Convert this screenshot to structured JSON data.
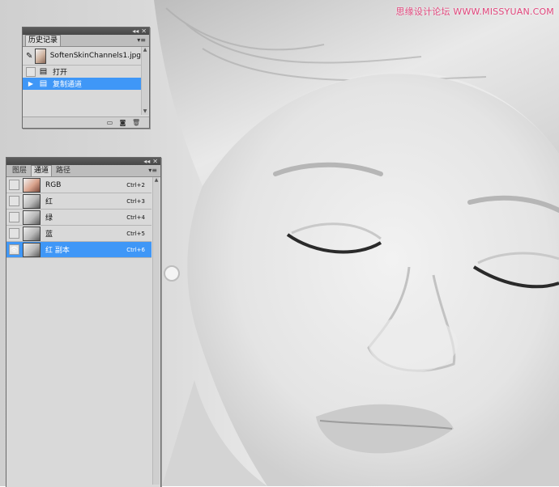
{
  "watermark": "思缘设计论坛 WWW.MISSYUAN.COM",
  "history_panel": {
    "tab": "历史记录",
    "snapshot": "SoftenSkinChannels1.jpg",
    "states": [
      {
        "label": "打开",
        "selected": false,
        "icon": "document-open-icon"
      },
      {
        "label": "复制通道",
        "selected": true,
        "icon": "duplicate-channel-icon"
      }
    ]
  },
  "channels_panel": {
    "tabs": [
      "图层",
      "通道",
      "路径"
    ],
    "active_tab": "通道",
    "channels": [
      {
        "name": "RGB",
        "shortcut": "Ctrl+2",
        "selected": false,
        "visible": false
      },
      {
        "name": "红",
        "shortcut": "Ctrl+3",
        "selected": false,
        "visible": false
      },
      {
        "name": "绿",
        "shortcut": "Ctrl+4",
        "selected": false,
        "visible": false
      },
      {
        "name": "蓝",
        "shortcut": "Ctrl+5",
        "selected": false,
        "visible": false
      },
      {
        "name": "红 副本",
        "shortcut": "Ctrl+6",
        "selected": true,
        "visible": true
      }
    ]
  },
  "colors": {
    "selection": "#3f97f7",
    "panel_bg": "#d9d9d9",
    "watermark": "#e0457b"
  }
}
